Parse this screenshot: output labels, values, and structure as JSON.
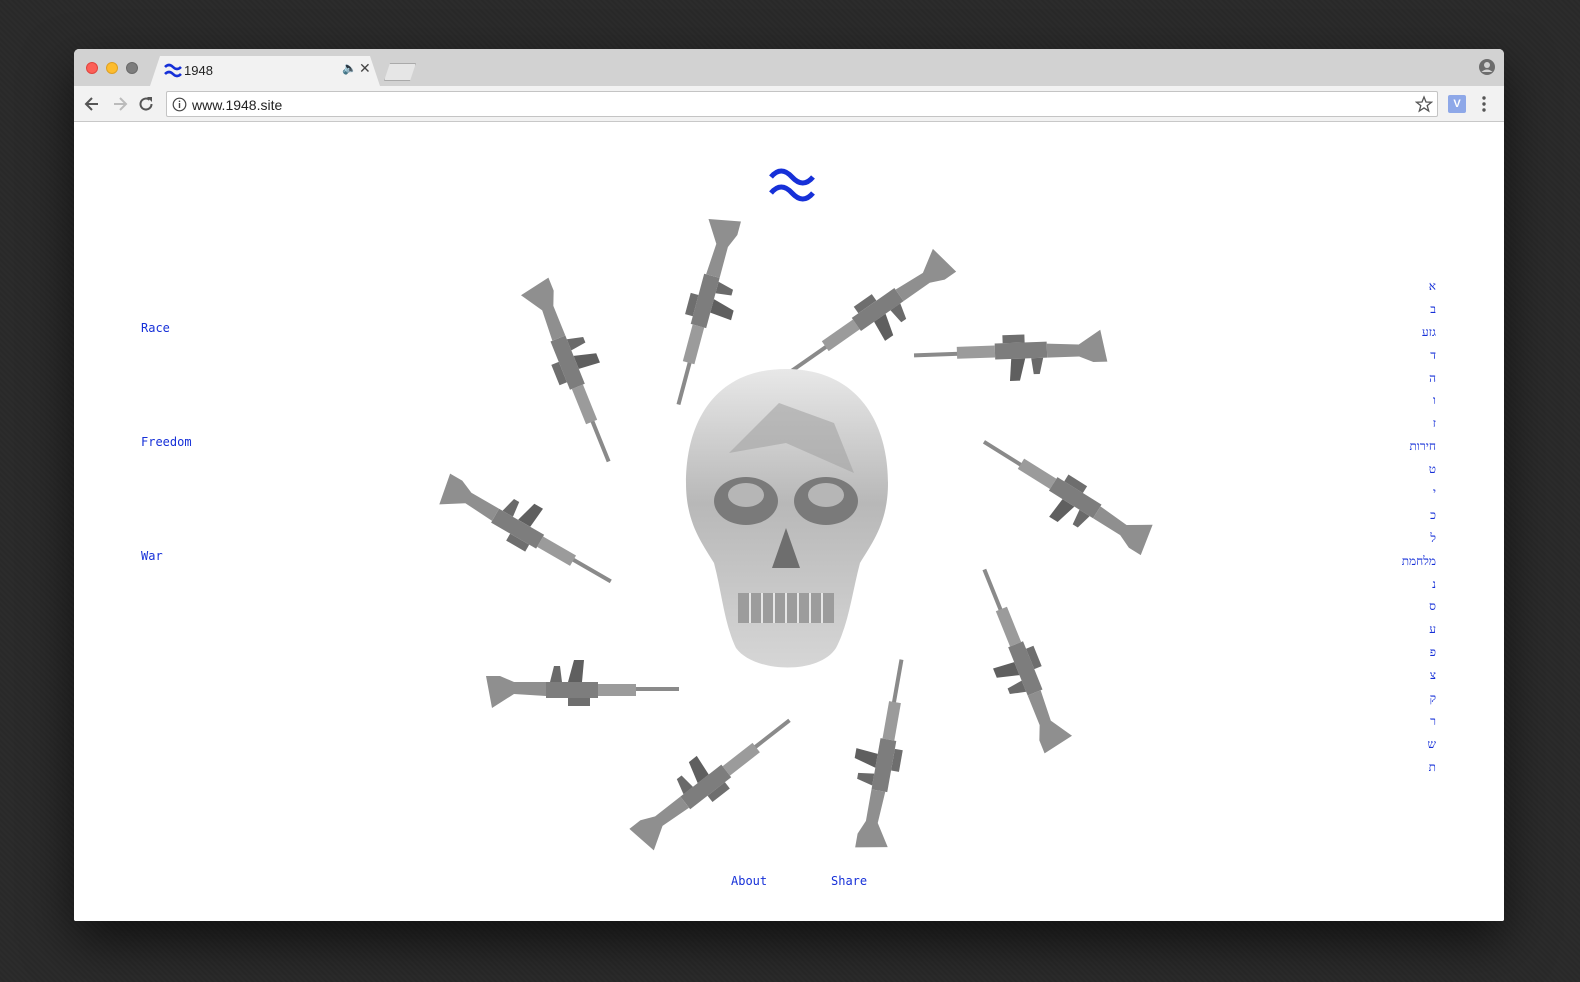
{
  "browser": {
    "tab_title": "1948",
    "url": "www.1948.site",
    "extension_label": "V"
  },
  "site": {
    "left_nav": [
      "Race",
      "Freedom",
      "War"
    ],
    "hebrew_index": [
      "א",
      "ב",
      "גזע",
      "ד",
      "ה",
      "ו",
      "ז",
      "חירות",
      "ט",
      "י",
      "כ",
      "ל",
      "מלחמת",
      "נ",
      "ס",
      "ע",
      "פ",
      "צ",
      "ק",
      "ר",
      "ש",
      "ת"
    ],
    "footer": {
      "about": "About",
      "share": "Share"
    }
  },
  "colors": {
    "accent": "#1630d8"
  }
}
